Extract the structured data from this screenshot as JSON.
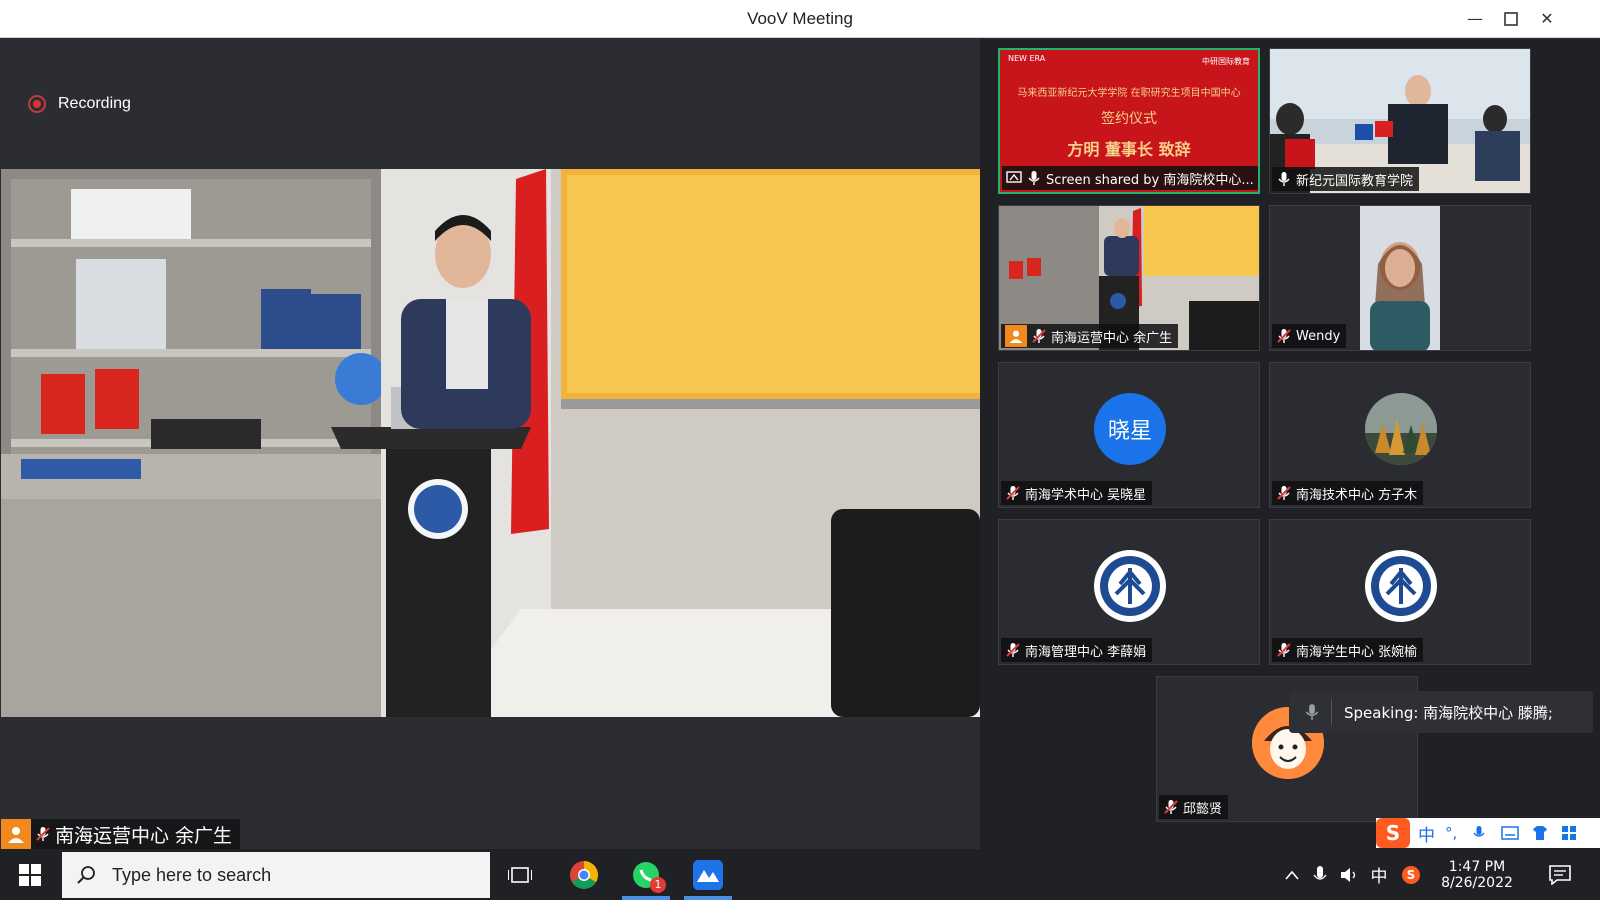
{
  "window": {
    "title": "VooV Meeting"
  },
  "recording": {
    "label": "Recording"
  },
  "main_video": {
    "name": "南海运营中心 余广生"
  },
  "slide": {
    "line1": "马来西亚新纪元大学学院 在职研究生项目中国中心",
    "line2": "签约仪式",
    "line3": "方明 董事长 致辞",
    "logo_left": "NEW ERA",
    "logo_right": "中研国际教育"
  },
  "tiles": [
    {
      "name": "Screen shared by 南海院校中心...",
      "kind": "screen"
    },
    {
      "name": "新纪元国际教育学院",
      "kind": "video"
    },
    {
      "name": "南海运营中心 余广生",
      "kind": "video"
    },
    {
      "name": "Wendy",
      "kind": "video"
    },
    {
      "name": "南海学术中心 吴晓星",
      "kind": "avatar",
      "initials": "晓星"
    },
    {
      "name": "南海技术中心 方子木",
      "kind": "avatar"
    },
    {
      "name": "南海管理中心 李薛娟",
      "kind": "logo"
    },
    {
      "name": "南海学生中心 张婉榆",
      "kind": "logo"
    },
    {
      "name": "邱懿贤",
      "kind": "avatar"
    }
  ],
  "speaking": {
    "text": "Speaking: 南海院校中心 滕腾;"
  },
  "ime": {
    "chars": [
      "中",
      "°,"
    ]
  },
  "taskbar": {
    "search_placeholder": "Type here to search",
    "whatsapp_badge": "1",
    "tray_lang": "中",
    "time": "1:47 PM",
    "date": "8/26/2022"
  },
  "colors": {
    "accent_blue": "#1a73e8",
    "recording_red": "#d33",
    "active_green": "#24b36b",
    "slide_red": "#c8151b"
  }
}
